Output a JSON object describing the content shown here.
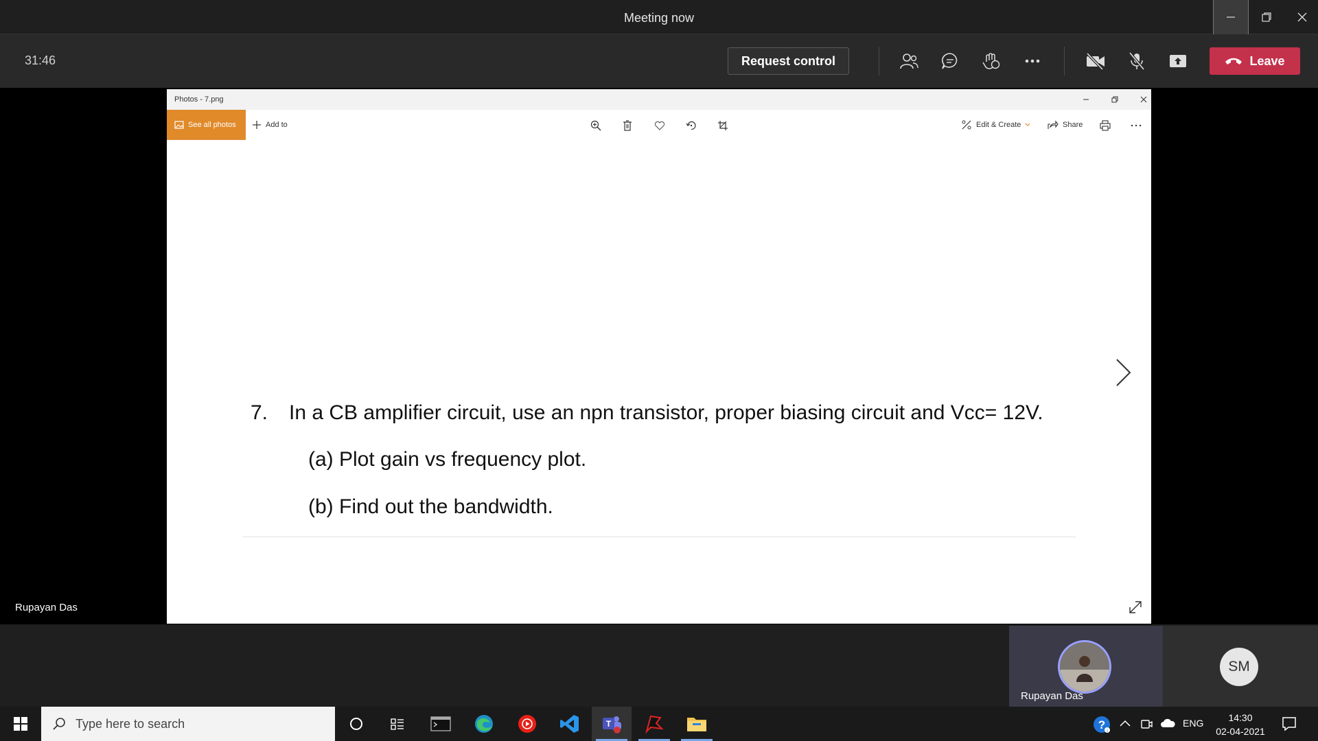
{
  "teams": {
    "window_title": "Meeting now",
    "timer": "31:46",
    "request_control": "Request control",
    "leave": "Leave",
    "presenter_name": "Rupayan Das"
  },
  "photos": {
    "window_title": "Photos - 7.png",
    "toolbar": {
      "see_all_photos": "See all photos",
      "add_to": "Add to",
      "edit_create": "Edit & Create",
      "share": "Share"
    },
    "image": {
      "question_number": "7.",
      "question_text": "In a CB amplifier circuit, use an npn transistor, proper biasing circuit and Vcc= 12V.",
      "part_a": "(a) Plot gain vs frequency plot.",
      "part_b": "(b) Find out the bandwidth."
    }
  },
  "participants": [
    {
      "name": "Rupayan Das",
      "kind": "photo-avatar"
    },
    {
      "initials": "SM",
      "kind": "initials-avatar"
    }
  ],
  "taskbar": {
    "search_placeholder": "Type here to search",
    "tray_language": "ENG",
    "time": "14:30",
    "date": "02-04-2021"
  },
  "colors": {
    "leave_red": "#c4314b",
    "photos_accent": "#e08a2a",
    "avatar_ring": "#9aa0ff"
  }
}
